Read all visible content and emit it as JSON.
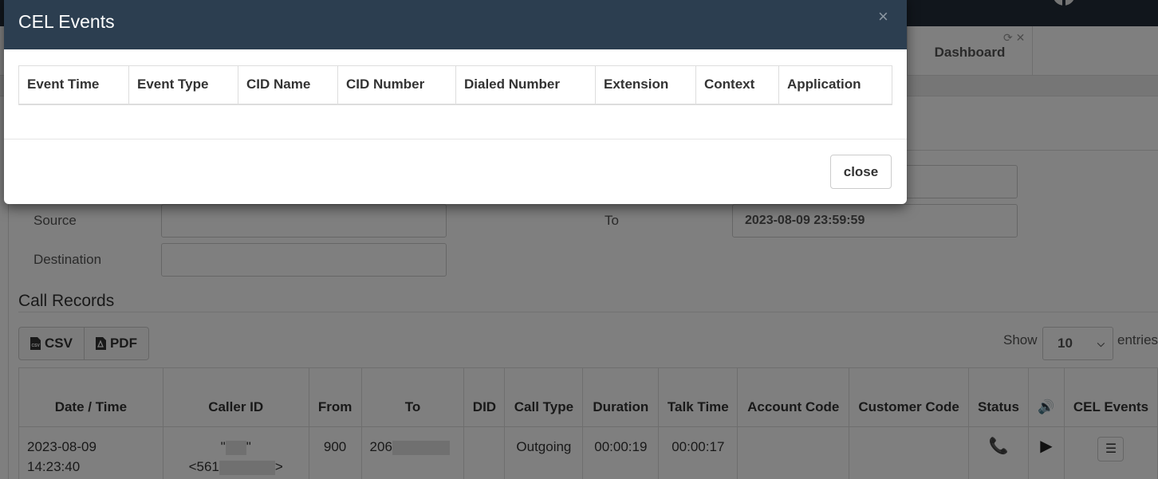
{
  "page": {
    "tab": {
      "label": "Dashboard"
    },
    "tab_tools": "⟳ ✕",
    "filters": {
      "source_label": "Source",
      "to_label": "To",
      "to_value": "2023-08-09 23:59:59",
      "destination_label": "Destination"
    },
    "section_title": "Call Records",
    "export": {
      "csv_label": "CSV",
      "pdf_label": "PDF"
    },
    "length": {
      "show_label": "Show",
      "selected": "10",
      "entries_label": "entries"
    },
    "table": {
      "headers": [
        "Date / Time",
        "Caller ID",
        "From",
        "To",
        "DID",
        "Call Type",
        "Duration",
        "Talk Time",
        "Account Code",
        "Customer Code",
        "Status",
        "🔊",
        "CEL Events"
      ],
      "rows": [
        {
          "date": "2023-08-09",
          "time": "14:23:40",
          "caller_quote_open": "\"",
          "caller_quote_close": "\"",
          "caller_num_prefix": "<561",
          "caller_num_suffix": ">",
          "from": "900",
          "to_prefix": "206",
          "did": "",
          "call_type": "Outgoing",
          "duration": "00:00:19",
          "talk_time": "00:00:17",
          "account_code": "",
          "customer_code": ""
        }
      ]
    }
  },
  "modal": {
    "title": "CEL Events",
    "close_icon": "×",
    "columns": [
      "Event Time",
      "Event Type",
      "CID Name",
      "CID Number",
      "Dialed Number",
      "Extension",
      "Context",
      "Application"
    ],
    "close_button": "close"
  },
  "colors": {
    "header_bg": "#2c3e50",
    "topbar_bg": "#222d38",
    "status_green": "#3c9b3c"
  }
}
